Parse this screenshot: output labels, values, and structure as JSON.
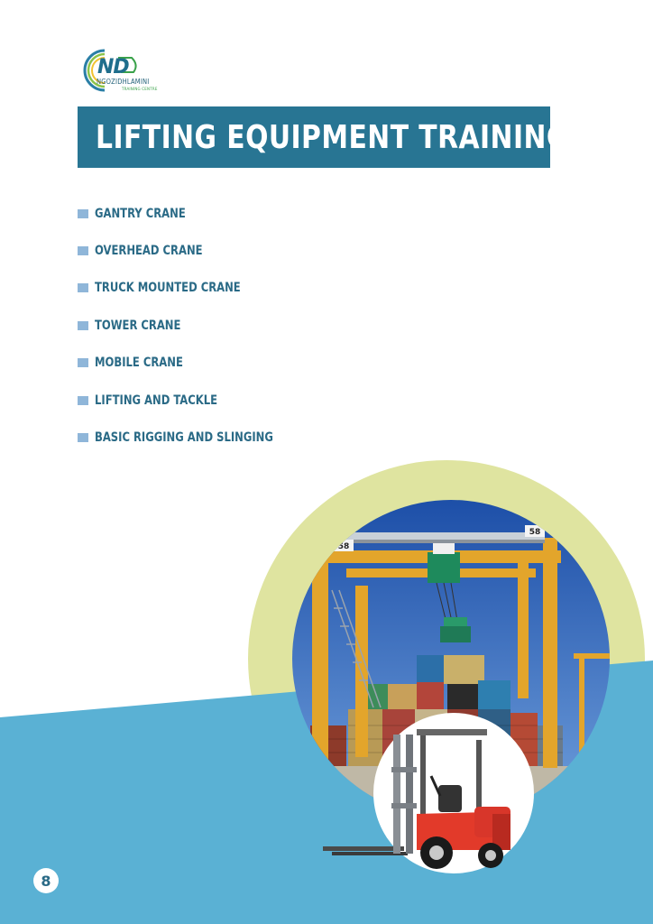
{
  "logo": {
    "initials": "ND",
    "name": "NGOZIDHLAMINI",
    "subtitle": "TRAINING CENTRE"
  },
  "title": "LIFTING EQUIPMENT TRAINING",
  "courses": [
    "GANTRY CRANE",
    "OVERHEAD CRANE",
    "TRUCK MOUNTED CRANE",
    "TOWER CRANE",
    "MOBILE CRANE",
    "LIFTING AND TACKLE",
    "BASIC RIGGING AND SLINGING"
  ],
  "crane_markings": {
    "left_number": "58",
    "right_number": "58"
  },
  "page_number": "8",
  "colors": {
    "banner": "#287593",
    "bullet": "#8fb6d9",
    "text": "#2a6a86",
    "band": "#5ab1d4",
    "green_circle": "#dfe4a0"
  }
}
